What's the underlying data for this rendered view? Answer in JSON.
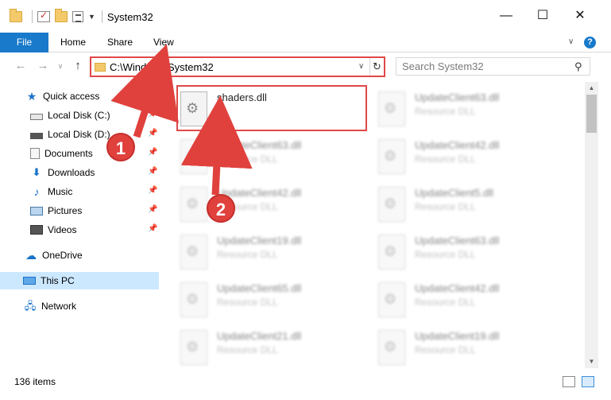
{
  "window": {
    "title": "System32",
    "minimize": "—",
    "maximize": "☐",
    "close": "✕"
  },
  "ribbon": {
    "tabs": [
      "File",
      "Home",
      "Share",
      "View"
    ],
    "help": "?"
  },
  "address": {
    "path": "C:\\Windows\\System32"
  },
  "search": {
    "placeholder": "Search System32"
  },
  "sidebar": {
    "items": [
      {
        "label": "Quick access",
        "icon": "star-icon"
      },
      {
        "label": "Local Disk (C:)",
        "icon": "drive-icon",
        "pinned": true
      },
      {
        "label": "Local Disk (D:)",
        "icon": "drive-icon",
        "pinned": true
      },
      {
        "label": "Documents",
        "icon": "documents-icon",
        "pinned": true
      },
      {
        "label": "Downloads",
        "icon": "downloads-icon",
        "pinned": true
      },
      {
        "label": "Music",
        "icon": "music-icon",
        "pinned": true
      },
      {
        "label": "Pictures",
        "icon": "pictures-icon",
        "pinned": true
      },
      {
        "label": "Videos",
        "icon": "videos-icon",
        "pinned": true
      },
      {
        "label": "OneDrive",
        "icon": "onedrive-icon"
      },
      {
        "label": "This PC",
        "icon": "pc-icon",
        "selected": true
      },
      {
        "label": "Network",
        "icon": "network-icon"
      }
    ]
  },
  "files": {
    "col1": [
      {
        "name": "shaders.dll",
        "type": ""
      },
      {
        "name": "UpdateClient63.dll",
        "type": "Resource DLL"
      },
      {
        "name": "UpdateClient42.dll",
        "type": "Resource DLL"
      },
      {
        "name": "UpdateClient19.dll",
        "type": "Resource DLL"
      },
      {
        "name": "UpdateClient65.dll",
        "type": "Resource DLL"
      },
      {
        "name": "UpdateClient21.dll",
        "type": "Resource DLL"
      }
    ],
    "col2": [
      {
        "name": "UpdateClient63.dll",
        "type": "Resource DLL"
      },
      {
        "name": "UpdateClient42.dll",
        "type": "Resource DLL"
      },
      {
        "name": "UpdateClient5.dll",
        "type": "Resource DLL"
      },
      {
        "name": "UpdateClient63.dll",
        "type": "Resource DLL"
      },
      {
        "name": "UpdateClient42.dll",
        "type": "Resource DLL"
      },
      {
        "name": "UpdateClient19.dll",
        "type": "Resource DLL"
      }
    ]
  },
  "status": {
    "item_count": "136 items"
  },
  "callouts": [
    "1",
    "2"
  ],
  "colors": {
    "accent": "#1979ca",
    "highlight": "#e04848",
    "selected_bg": "#cce8ff"
  }
}
